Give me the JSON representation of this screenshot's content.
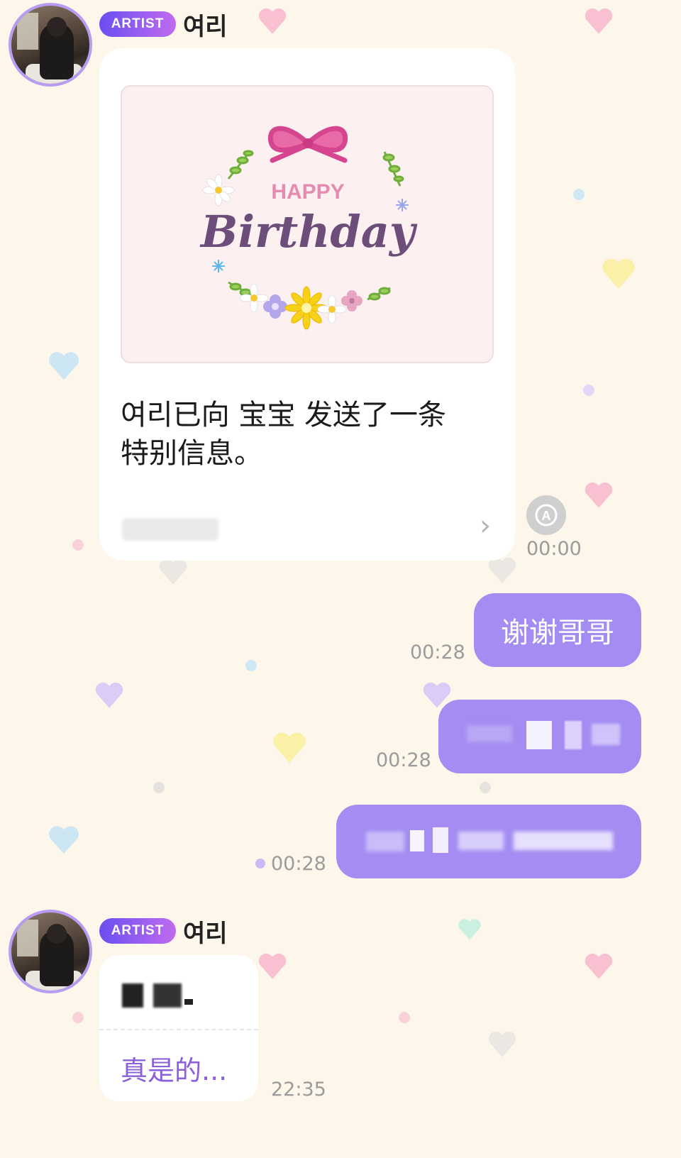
{
  "messages": [
    {
      "sender": {
        "badge": "ARTIST",
        "name": "여리"
      },
      "card": {
        "image": {
          "happy": "HAPPY",
          "birthday": "Birthday"
        },
        "text_line1": "여리已向 宝宝 发送了一条",
        "text_line2": "特别信息。",
        "arrow": "›"
      },
      "time": "00:00"
    },
    {
      "text": "谢谢哥哥",
      "time": "00:28"
    },
    {
      "text": "",
      "time": "00:28"
    },
    {
      "text": "",
      "time": "00:28"
    },
    {
      "sender": {
        "badge": "ARTIST",
        "name": "여리"
      },
      "reply": {
        "translated": "真是的..."
      },
      "time": "22:35"
    }
  ],
  "icons": {
    "translate": "translate-icon",
    "avatar": "avatar-icon"
  },
  "colors": {
    "background": "#fdf6ea",
    "my_bubble": "#a48cf2",
    "badge_start": "#6a4ff0",
    "badge_end": "#c06bf0",
    "reply_text": "#8b5fd9"
  }
}
